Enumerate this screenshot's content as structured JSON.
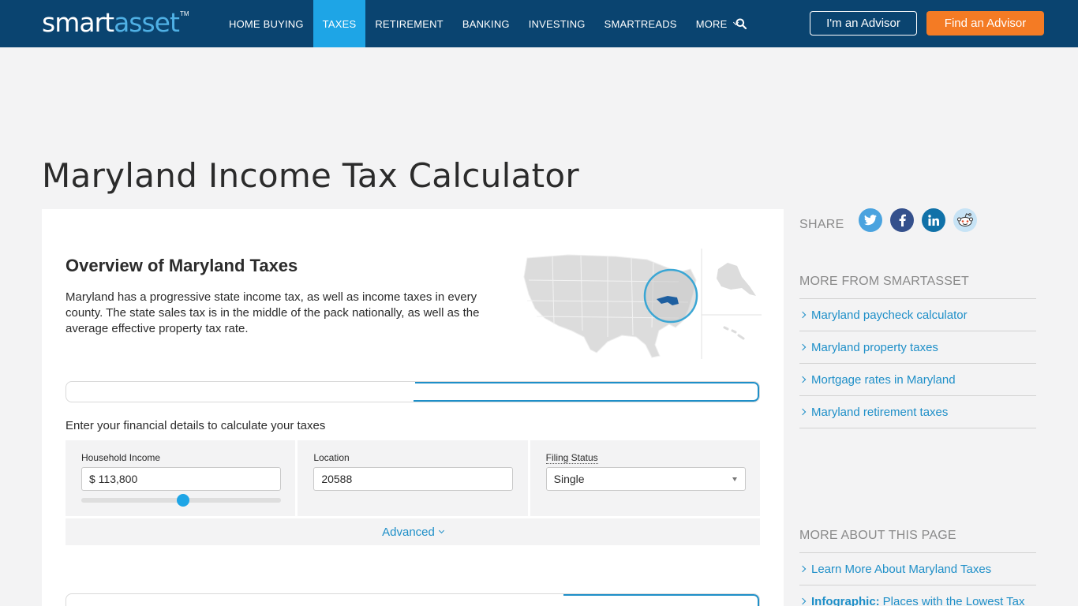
{
  "header": {
    "logo_smart": "smart",
    "logo_asset": "asset",
    "logo_tm": "TM",
    "nav": [
      {
        "label": "HOME BUYING",
        "active": false
      },
      {
        "label": "TAXES",
        "active": true
      },
      {
        "label": "RETIREMENT",
        "active": false
      },
      {
        "label": "BANKING",
        "active": false
      },
      {
        "label": "INVESTING",
        "active": false
      },
      {
        "label": "SMARTREADS",
        "active": false
      },
      {
        "label": "MORE",
        "active": false
      }
    ],
    "advisor_button": "I'm an Advisor",
    "find_button": "Find an Advisor"
  },
  "page": {
    "title": "Maryland Income Tax Calculator"
  },
  "overview": {
    "heading": "Overview of Maryland Taxes",
    "text": "Maryland has a progressive state income tax, as well as income taxes in every county. The state sales tax is in the middle of the pack nationally, as well as the average effective property tax rate."
  },
  "calculator": {
    "enter_details": "Enter your financial details to calculate your taxes",
    "income_label": "Household Income",
    "income_value": "$ 113,800",
    "income_slider_fraction": 0.51,
    "location_label": "Location",
    "location_value": "20588",
    "filing_label": "Filing Status",
    "filing_value": "Single",
    "advanced_label": "Advanced"
  },
  "sidebar": {
    "share_label": "SHARE",
    "more_from_heading": "MORE FROM SMARTASSET",
    "more_from_links": [
      "Maryland paycheck calculator",
      "Maryland property taxes",
      "Mortgage rates in Maryland",
      "Maryland retirement taxes"
    ],
    "more_about_heading": "MORE ABOUT THIS PAGE",
    "more_about_link_1": "Learn More About Maryland Taxes",
    "more_about_link_2_bold": "Infographic:",
    "more_about_link_2_rest": "Places with the Lowest Tax"
  },
  "colors": {
    "header_bg": "#0a4470",
    "active_tab": "#1ea5e6",
    "cta_orange": "#f47b24",
    "link_blue": "#1e8fc8"
  }
}
